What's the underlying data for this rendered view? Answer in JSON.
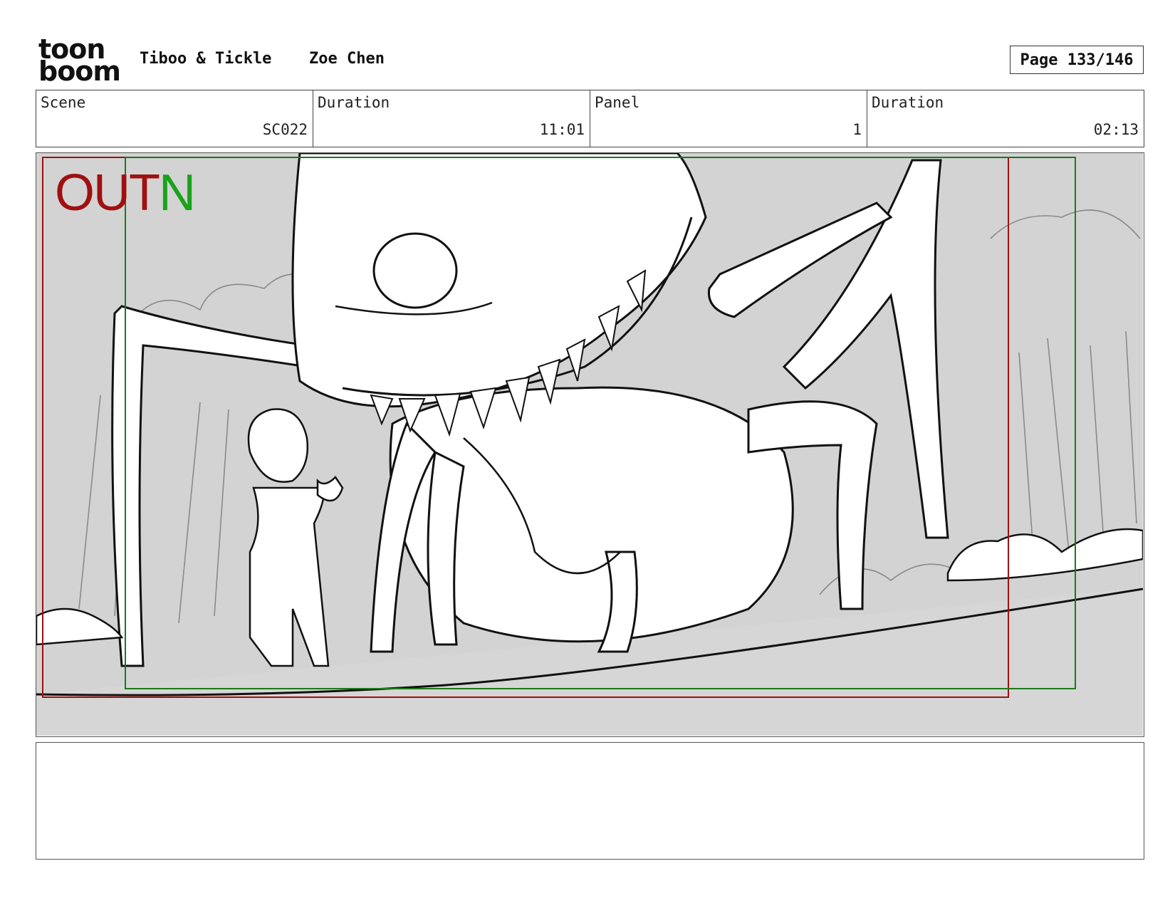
{
  "header": {
    "logo_line1": "toon",
    "logo_line2": "boom",
    "show_title": "Tiboo & Tickle",
    "artist": "Zoe Chen",
    "page": "Page 133/146"
  },
  "info": [
    {
      "label": "Scene",
      "value": "SC022"
    },
    {
      "label": "Duration",
      "value": "11:01"
    },
    {
      "label": "Panel",
      "value": "1"
    },
    {
      "label": "Duration",
      "value": "02:13"
    }
  ],
  "panel": {
    "out_text": "OUT",
    "in_text": "N",
    "colors": {
      "out_frame": "#a01010",
      "in_frame": "#1a7a1a",
      "background": "#d3d3d3",
      "line": "#111111"
    }
  },
  "notes": {
    "text": ""
  }
}
